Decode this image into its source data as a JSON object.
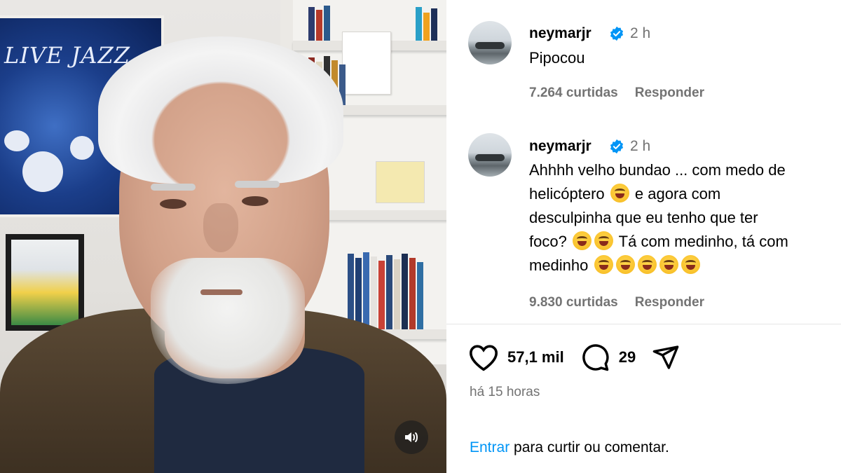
{
  "comments": [
    {
      "username": "neymarjr",
      "time": "2 h",
      "text": "Pipocou",
      "likes": "7.264 curtidas",
      "reply_label": "Responder"
    },
    {
      "username": "neymarjr",
      "time": "2 h",
      "text_line1": "Ahhhh velho bundao ... com medo de",
      "text_line2": "helicóptero",
      "text_line2b": "e agora com",
      "text_line3": "desculpinha que eu tenho que ter",
      "text_line4a": "foco?",
      "text_line4b": "Tá com medinho, tá com",
      "text_line5": "medinho",
      "likes": "9.830 curtidas",
      "reply_label": "Responder"
    }
  ],
  "post": {
    "likes": "57,1 mil",
    "comments": "29",
    "posted_ago": "há 15 horas"
  },
  "login": {
    "link": "Entrar",
    "text": "para curtir ou comentar."
  },
  "video": {
    "poster_text": "LIVE JAZZ"
  },
  "colors": {
    "verified": "#0095f6",
    "link": "#0095f6",
    "muted": "#737373"
  },
  "icons": [
    "verified-badge-icon",
    "heart-icon",
    "comment-icon",
    "share-icon",
    "volume-icon",
    "laughing-emoji-icon"
  ]
}
